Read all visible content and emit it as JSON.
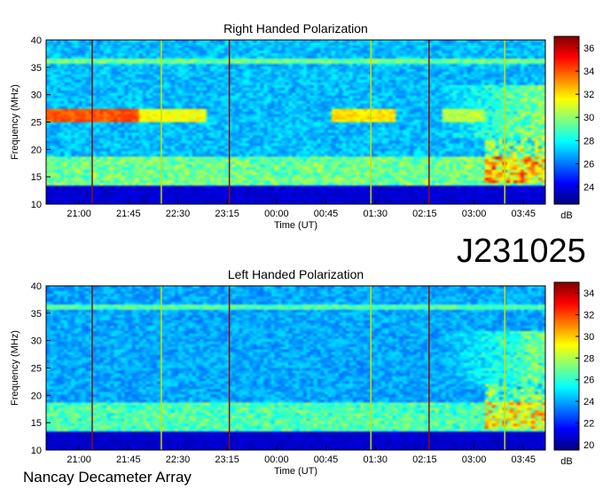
{
  "observation_id": "J231025",
  "observatory": "Nancay Decameter Array",
  "colors": {
    "colormap": [
      "#00007f",
      "#0000ff",
      "#007fff",
      "#00ffff",
      "#7fff7f",
      "#ffff00",
      "#ff7f00",
      "#ff0000",
      "#7f0000"
    ],
    "vertical_lines": [
      "#8a1010",
      "#c8e000"
    ]
  },
  "chart_data": [
    {
      "type": "heatmap",
      "title": "Right Handed Polarization",
      "xlabel": "Time (UT)",
      "ylabel": "Frequency (MHz)",
      "x_ticks": [
        "21:00",
        "21:45",
        "22:30",
        "23:15",
        "00:00",
        "00:45",
        "01:30",
        "02:15",
        "03:00",
        "03:45"
      ],
      "y_ticks": [
        10,
        15,
        20,
        25,
        30,
        35,
        40
      ],
      "ylim": [
        10,
        40
      ],
      "colorbar": {
        "label": "dB",
        "ticks": [
          24,
          26,
          28,
          30,
          32,
          34,
          36
        ],
        "range": [
          22.5,
          37
        ]
      },
      "features": {
        "emission_band_mhz": [
          25,
          27.5
        ],
        "emission_band_segments": [
          {
            "start": "20:30",
            "end": "21:55",
            "level_db": 34
          },
          {
            "start": "21:55",
            "end": "22:55",
            "level_db": 31.5
          },
          {
            "start": "00:50",
            "end": "01:50",
            "level_db": 32
          },
          {
            "start": "02:30",
            "end": "03:10",
            "level_db": 30.5
          }
        ],
        "background_db": 27,
        "interference_line_mhz": 36.2,
        "vertical_lines_ut": [
          "21:12",
          "22:15",
          "23:17",
          "01:26",
          "02:19",
          "03:28"
        ]
      }
    },
    {
      "type": "heatmap",
      "title": "Left Handed Polarization",
      "xlabel": "Time (UT)",
      "ylabel": "Frequency (MHz)",
      "x_ticks": [
        "21:00",
        "21:45",
        "22:30",
        "23:15",
        "00:00",
        "00:45",
        "01:30",
        "02:15",
        "03:00",
        "03:45"
      ],
      "y_ticks": [
        10,
        15,
        20,
        25,
        30,
        35,
        40
      ],
      "ylim": [
        10,
        40
      ],
      "colorbar": {
        "label": "dB",
        "ticks": [
          20,
          22,
          24,
          26,
          28,
          30,
          32,
          34
        ],
        "range": [
          19.5,
          35
        ]
      },
      "features": {
        "background_db": 24,
        "interference_line_mhz": 36.2,
        "vertical_lines_ut": [
          "21:12",
          "22:15",
          "23:17",
          "01:26",
          "02:19",
          "03:28"
        ]
      }
    }
  ]
}
